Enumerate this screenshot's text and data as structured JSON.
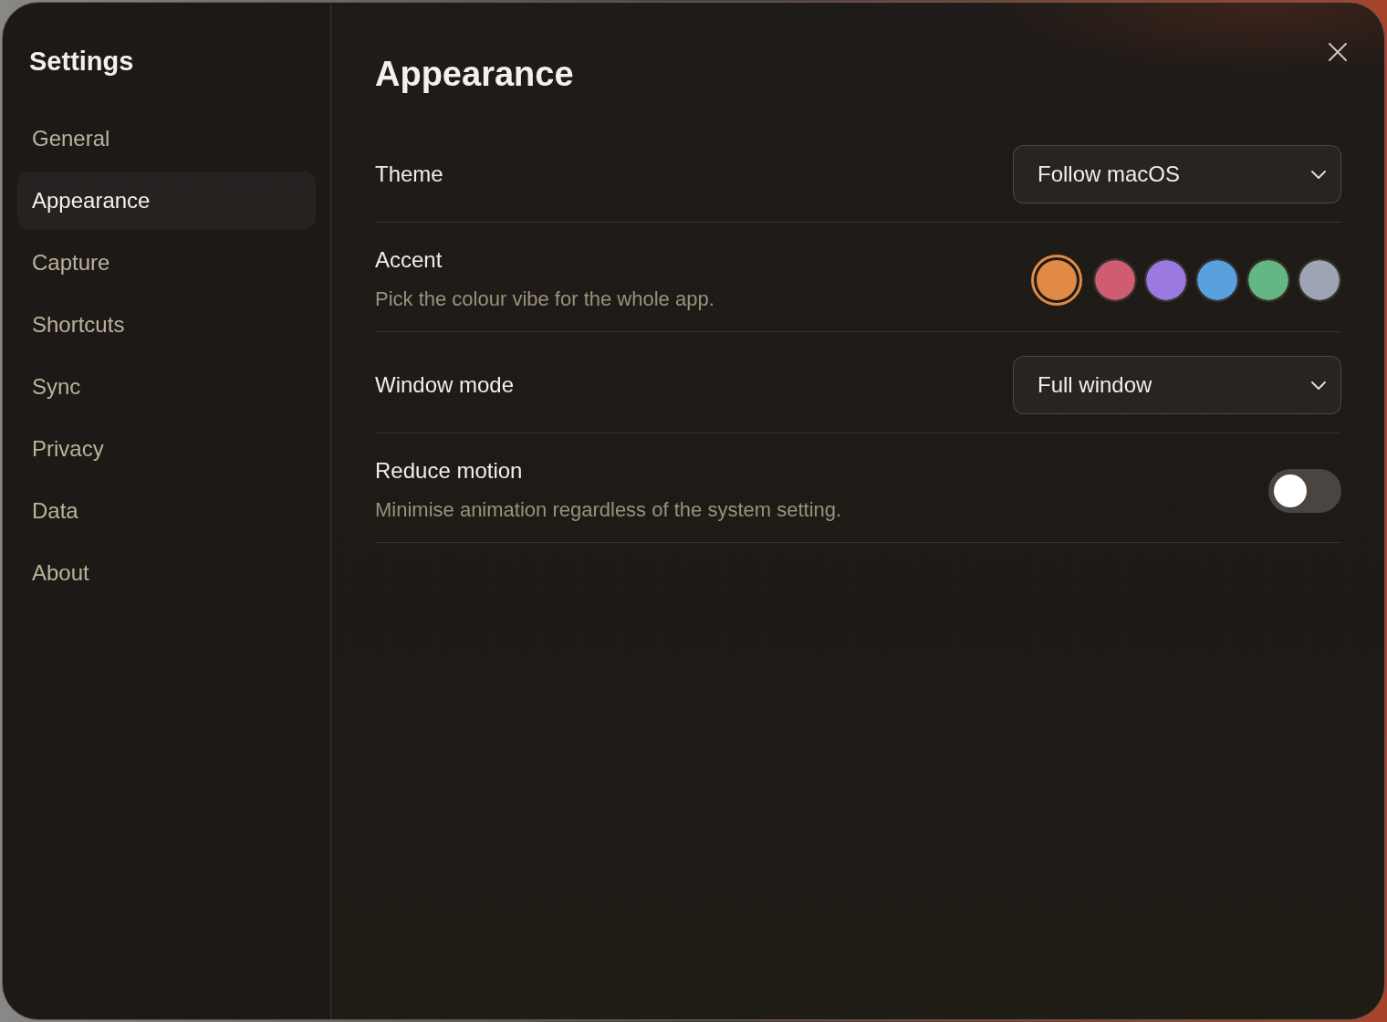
{
  "window": {
    "title": "Settings"
  },
  "sidebar": {
    "items": [
      {
        "label": "General",
        "selected": false
      },
      {
        "label": "Appearance",
        "selected": true
      },
      {
        "label": "Capture",
        "selected": false
      },
      {
        "label": "Shortcuts",
        "selected": false
      },
      {
        "label": "Sync",
        "selected": false
      },
      {
        "label": "Privacy",
        "selected": false
      },
      {
        "label": "Data",
        "selected": false
      },
      {
        "label": "About",
        "selected": false
      }
    ]
  },
  "page": {
    "title": "Appearance"
  },
  "settings": [
    {
      "kind": "dropdown",
      "label": "Theme",
      "value": "Follow macOS"
    },
    {
      "kind": "swatches",
      "label": "Accent",
      "description": "Pick the colour vibe for the whole app.",
      "swatches": [
        {
          "color": "#e08a45",
          "selected": true
        },
        {
          "color": "#d05c72",
          "selected": false
        },
        {
          "color": "#9a7ae0",
          "selected": false
        },
        {
          "color": "#59a0de",
          "selected": false
        },
        {
          "color": "#62b784",
          "selected": false
        },
        {
          "color": "#9ea4b4",
          "selected": false
        }
      ]
    },
    {
      "kind": "dropdown",
      "label": "Window mode",
      "value": "Full window"
    },
    {
      "kind": "toggle",
      "label": "Reduce motion",
      "description": "Minimise animation regardless of the system setting.",
      "on": false
    }
  ]
}
